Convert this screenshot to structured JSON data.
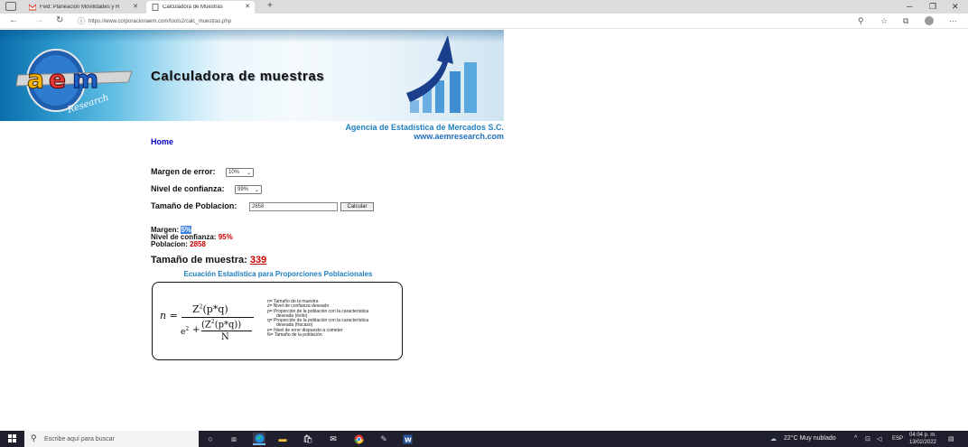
{
  "browser": {
    "tabs": [
      {
        "label": "Fwd: Planeación Movilidades y R",
        "active": false
      },
      {
        "label": "Calculadora de Muestras",
        "active": true
      }
    ],
    "new_tab": "+",
    "url": "https://www.corporacionaem.com/tools2/calc_muestras.php",
    "window_controls": [
      "minimize-icon",
      "restore-icon",
      "close-icon"
    ]
  },
  "banner": {
    "title": "Calculadora de muestras",
    "logo_text": "aem",
    "logo_subtext": "Research"
  },
  "agency": {
    "name": "Agencia de Estadística de Mercados S.C.",
    "url": "www.aemresearch.com"
  },
  "nav": {
    "home": "Home"
  },
  "form": {
    "margin_label": "Margen de error:",
    "margin_value": "10%",
    "confidence_label": "Nivel de confianza:",
    "confidence_value": "99%",
    "population_label": "Tamaño de Poblacion:",
    "population_value": "2858",
    "submit_label": "Calcular"
  },
  "results": {
    "margin_label": "Margen: ",
    "margin_value": "5%",
    "confidence_label": "Nivel de confianza: ",
    "confidence_value": "95%",
    "population_label": "Poblacion: ",
    "population_value": "2858",
    "sample_label": "Tamaño de muestra: ",
    "sample_value": "339"
  },
  "equation": {
    "title": "Ecuación Estadística para Proporciones Poblacionales",
    "n": "n =",
    "numerator": "Z",
    "numerator_tail": "(p*q)",
    "denominator_e": "e",
    "denominator_num": "(Z",
    "denominator_num_tail": "(p*q))",
    "denominator_den": "N",
    "superscript": "2",
    "plus": "+",
    "legend": [
      "n= Tamaño de la muestra",
      "z= Nivel de confianza deseado",
      "p= Proporción de la población con la característica",
      "deseada (éxito)",
      "q= Proporción de la población con la característica",
      "deseada (fracaso)",
      "e= Nivel de error dispuesto a cometer",
      "N= Tamaño de la población"
    ]
  },
  "taskbar": {
    "search_placeholder": "Escribe aquí para buscar",
    "weather": "22°C  Muy nublado",
    "language": "ESP",
    "time": "04:04 p. m.",
    "date": "13/02/2022"
  }
}
